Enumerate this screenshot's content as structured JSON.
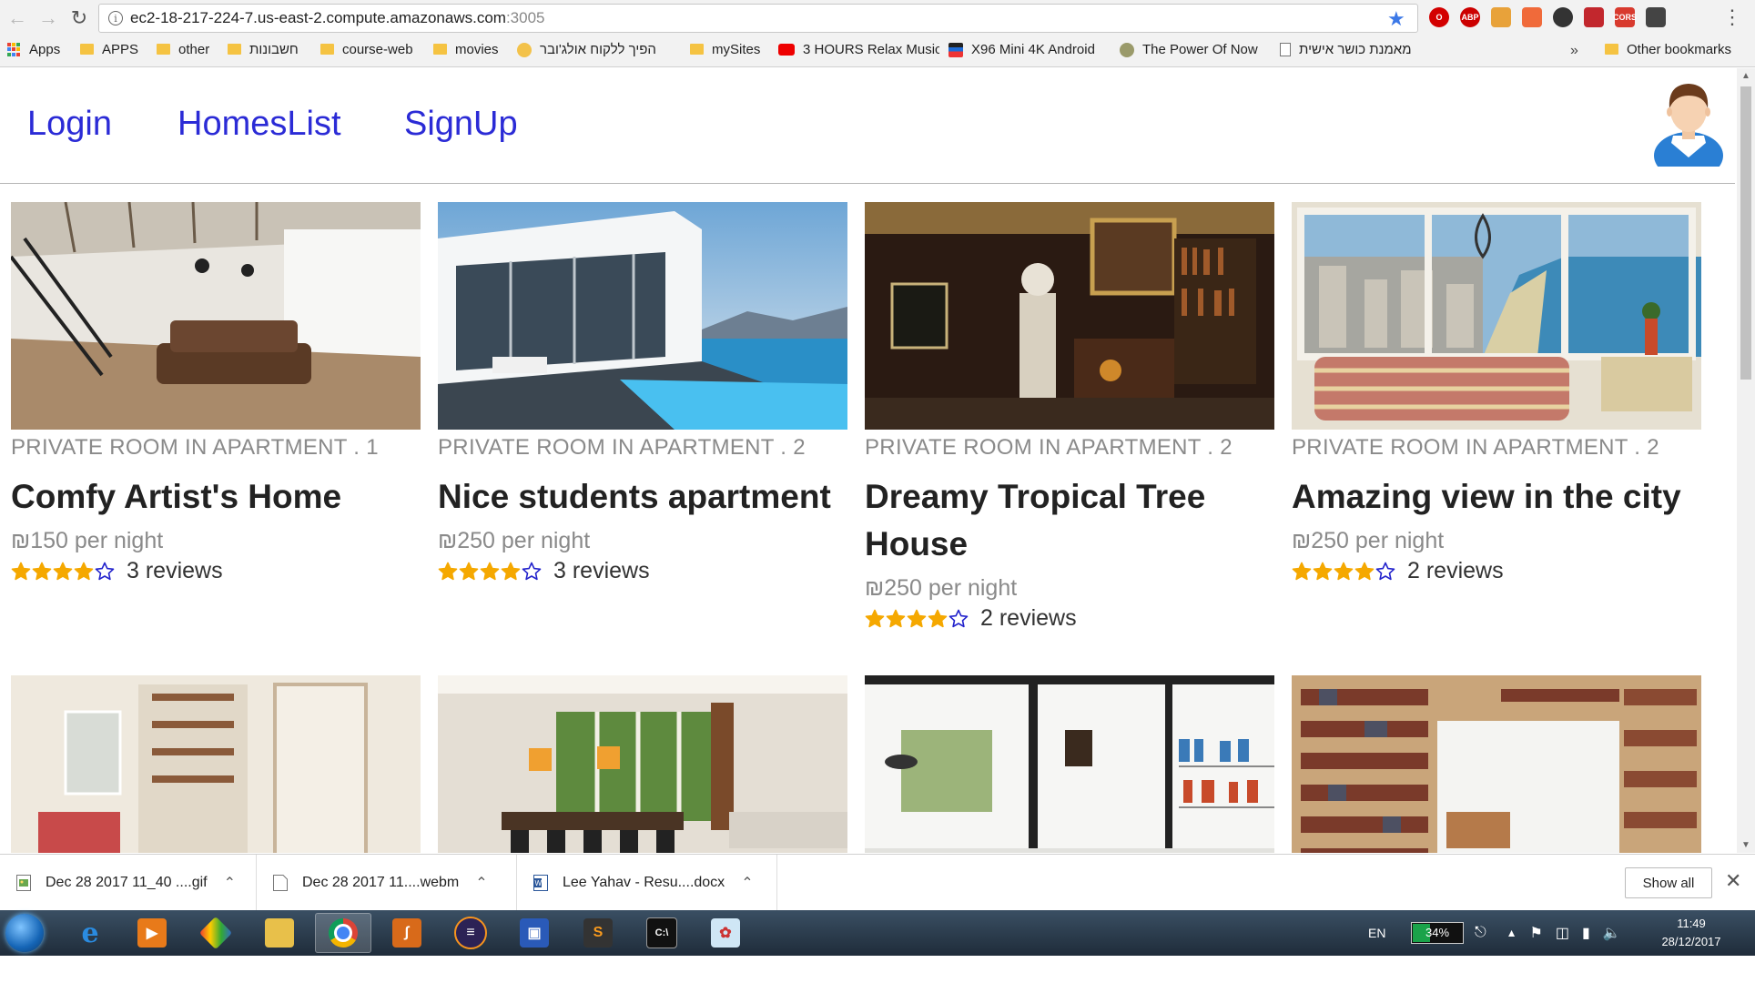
{
  "browser": {
    "url_host": "ec2-18-217-224-7.us-east-2.compute.amazonaws.com",
    "url_port": ":3005"
  },
  "bookmarks": [
    {
      "label": "Apps",
      "icon": "apps-grid-icon"
    },
    {
      "label": "APPS",
      "icon": "folder-icon"
    },
    {
      "label": "other",
      "icon": "folder-icon"
    },
    {
      "label": "חשבונות",
      "icon": "folder-icon"
    },
    {
      "label": "course-web",
      "icon": "folder-icon"
    },
    {
      "label": "movies",
      "icon": "folder-icon"
    },
    {
      "label": "הפיך ללקוח אולג'ובר",
      "icon": "site-favicon"
    },
    {
      "label": "mySites",
      "icon": "folder-icon"
    },
    {
      "label": "3 HOURS Relax Music",
      "icon": "youtube-icon"
    },
    {
      "label": "X96 Mini 4K Android",
      "icon": "site-favicon"
    },
    {
      "label": "The Power Of Now",
      "icon": "site-favicon"
    },
    {
      "label": "מאמנת כושר אישית",
      "icon": "page-icon"
    },
    {
      "label": "»",
      "icon": ""
    },
    {
      "label": "Other bookmarks",
      "icon": "folder-icon"
    }
  ],
  "site_nav": {
    "login": "Login",
    "homes_list": "HomesList",
    "signup": "SignUp"
  },
  "listings": [
    {
      "meta": "PRIVATE ROOM IN APARTMENT . 1",
      "title": "Comfy Artist's Home",
      "price": "₪150 per night",
      "stars": 4,
      "reviews": "3 reviews"
    },
    {
      "meta": "PRIVATE ROOM IN APARTMENT . 2",
      "title": "Nice students apartment",
      "price": "₪250 per night",
      "stars": 4,
      "reviews": "3 reviews"
    },
    {
      "meta": "PRIVATE ROOM IN APARTMENT . 2",
      "title": "Dreamy Tropical Tree House",
      "price": "₪250 per night",
      "stars": 4,
      "reviews": "2 reviews"
    },
    {
      "meta": "PRIVATE ROOM IN APARTMENT . 2",
      "title": "Amazing view in the city",
      "price": "₪250 per night",
      "stars": 4,
      "reviews": "2 reviews"
    }
  ],
  "downloads": [
    {
      "name": "Dec 28 2017 11_40 ....gif",
      "icon": "image-file-icon"
    },
    {
      "name": "Dec 28 2017 11....webm",
      "icon": "blank-file-icon"
    },
    {
      "name": "Lee Yahav - Resu....docx",
      "icon": "word-file-icon"
    }
  ],
  "downloads_show_all": "Show all",
  "tray": {
    "language": "EN",
    "battery": "34%",
    "battery_level": 0.34,
    "time": "11:49",
    "date": "28/12/2017"
  },
  "colors": {
    "nav_link": "#2b2bd6",
    "star": "#f5a800",
    "star_empty_outline": "#2222cc"
  }
}
